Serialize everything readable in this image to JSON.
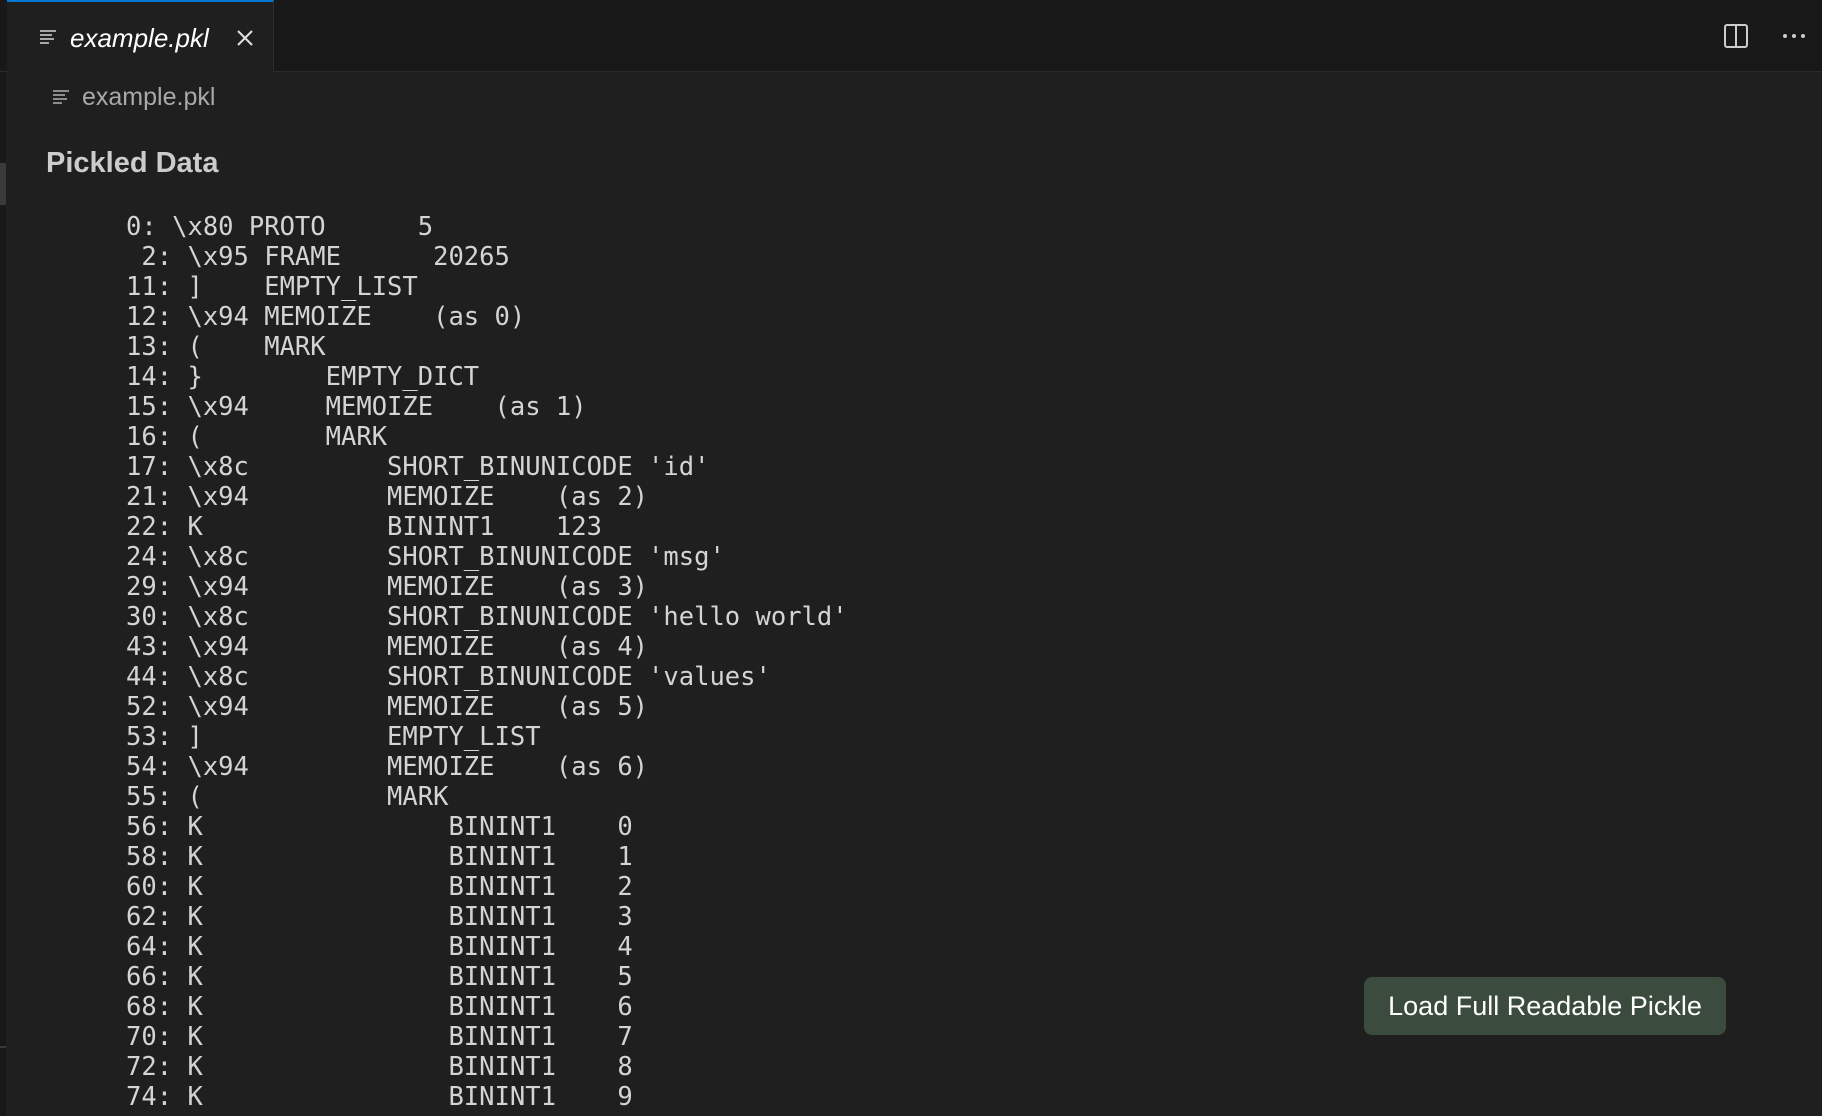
{
  "tab": {
    "label": "example.pkl",
    "icon": "text-file-icon",
    "close_icon": "close-icon",
    "active_border_color": "#0078d4"
  },
  "editor_actions": [
    {
      "name": "split-editor-icon"
    },
    {
      "name": "more-actions-icon"
    }
  ],
  "breadcrumb": {
    "label": "example.pkl",
    "icon": "text-file-icon"
  },
  "content": {
    "title": "Pickled Data",
    "disassembly": "   0: \\x80 PROTO      5\n    2: \\x95 FRAME      20265\n   11: ]    EMPTY_LIST\n   12: \\x94 MEMOIZE    (as 0)\n   13: (    MARK\n   14: }        EMPTY_DICT\n   15: \\x94     MEMOIZE    (as 1)\n   16: (        MARK\n   17: \\x8c         SHORT_BINUNICODE 'id'\n   21: \\x94         MEMOIZE    (as 2)\n   22: K            BININT1    123\n   24: \\x8c         SHORT_BINUNICODE 'msg'\n   29: \\x94         MEMOIZE    (as 3)\n   30: \\x8c         SHORT_BINUNICODE 'hello world'\n   43: \\x94         MEMOIZE    (as 4)\n   44: \\x8c         SHORT_BINUNICODE 'values'\n   52: \\x94         MEMOIZE    (as 5)\n   53: ]            EMPTY_LIST\n   54: \\x94         MEMOIZE    (as 6)\n   55: (            MARK\n   56: K                BININT1    0\n   58: K                BININT1    1\n   60: K                BININT1    2\n   62: K                BININT1    3\n   64: K                BININT1    4\n   66: K                BININT1    5\n   68: K                BININT1    6\n   70: K                BININT1    7\n   72: K                BININT1    8\n   74: K                BININT1    9"
  },
  "load_button": {
    "label": "Load Full Readable Pickle",
    "background": "#3b4b3d"
  }
}
